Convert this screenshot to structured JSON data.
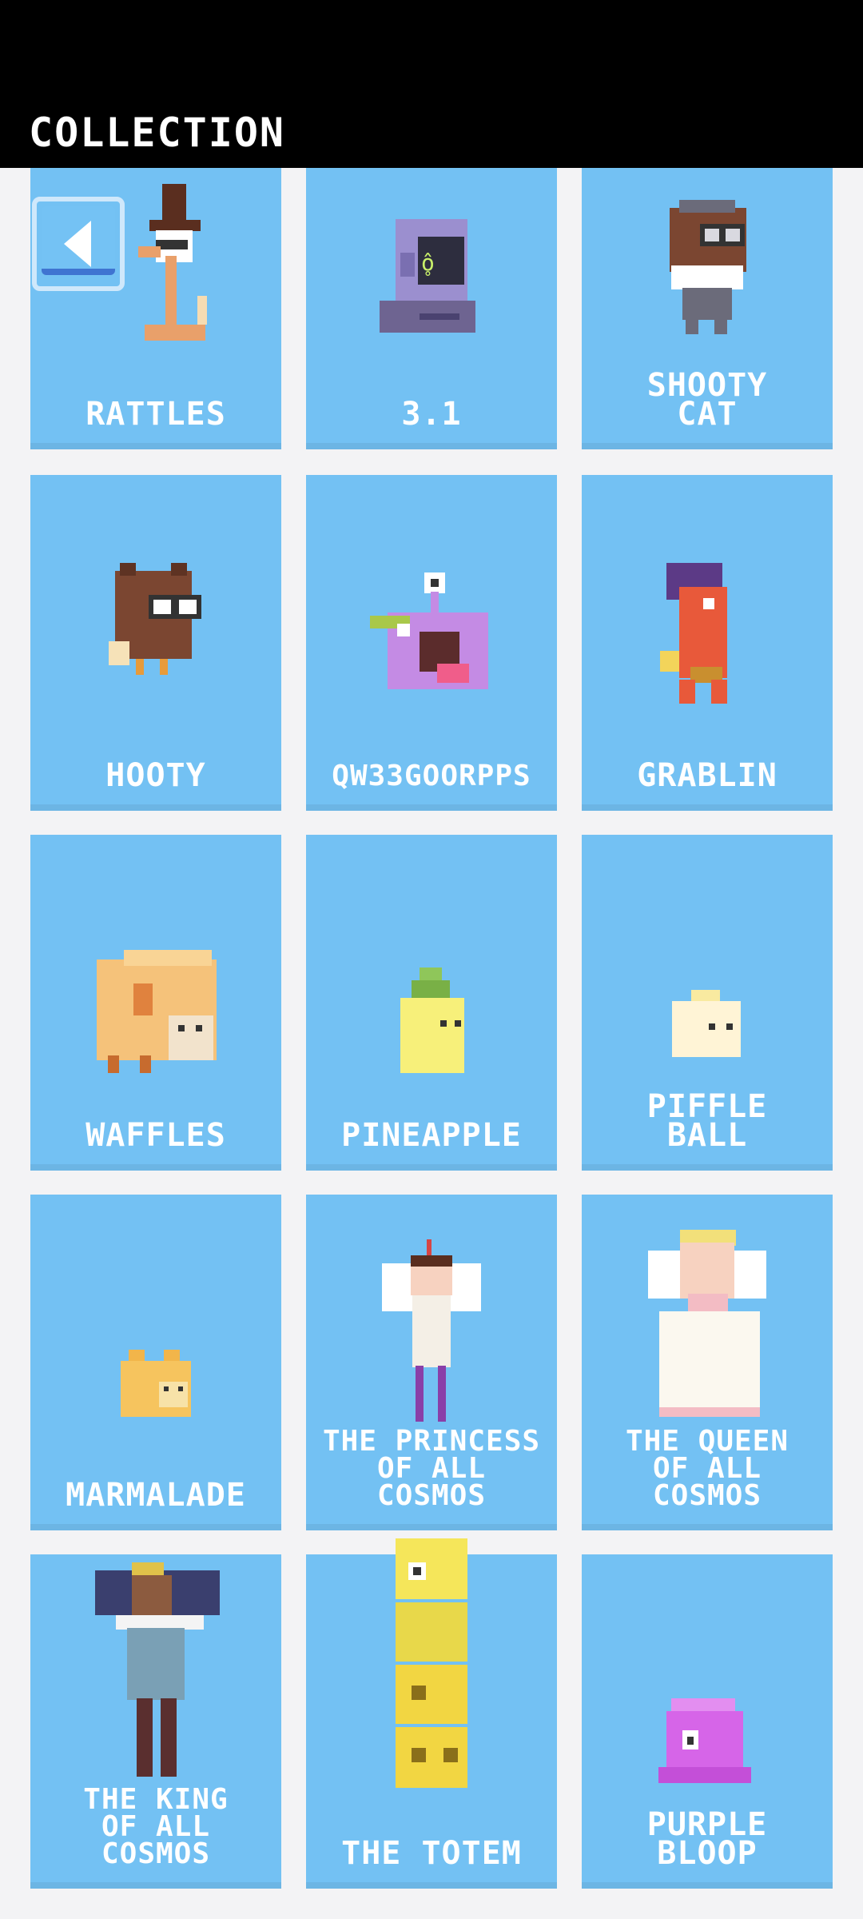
{
  "header": {
    "title": "COLLECTION"
  },
  "cards": [
    {
      "name": "RATTLES"
    },
    {
      "name": "3.1"
    },
    {
      "name": "SHOOTY\nCAT"
    },
    {
      "name": "HOOTY"
    },
    {
      "name": "QW33GOORPPS"
    },
    {
      "name": "GRABLIN"
    },
    {
      "name": "WAFFLES"
    },
    {
      "name": "PINEAPPLE"
    },
    {
      "name": "PIFFLE\nBALL"
    },
    {
      "name": "MARMALADE"
    },
    {
      "name": "THE PRINCESS\nOF ALL\nCOSMOS"
    },
    {
      "name": "THE QUEEN\nOF ALL\nCOSMOS"
    },
    {
      "name": "THE KING\nOF ALL\nCOSMOS"
    },
    {
      "name": "THE TOTEM"
    },
    {
      "name": "PURPLE\nBLOOP"
    }
  ],
  "back_button": {
    "icon": "back-arrow-icon"
  },
  "colors": {
    "card": "#73c1f3",
    "background": "#f3f3f5",
    "header": "#000000"
  }
}
